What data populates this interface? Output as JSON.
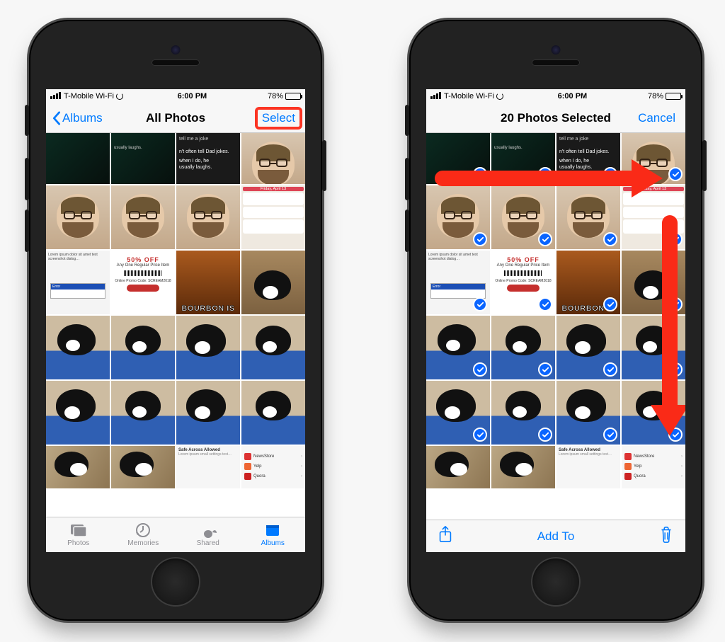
{
  "status": {
    "carrier": "T-Mobile Wi-Fi",
    "time": "6:00 PM",
    "battery_pct": "78%"
  },
  "left": {
    "back_label": "Albums",
    "title": "All Photos",
    "select_label": "Select",
    "tabs": {
      "photos": "Photos",
      "memories": "Memories",
      "shared": "Shared",
      "albums": "Albums"
    }
  },
  "right": {
    "title": "20 Photos Selected",
    "cancel_label": "Cancel",
    "toolbar": {
      "add_to": "Add To"
    }
  },
  "thumbs": {
    "bourbon_caption": "BOURBON IS",
    "coupon_headline": "50% OFF",
    "coupon_sub": "Any One Regular Price Item",
    "siri_lines": {
      "a": "tell me a joke",
      "b": "n't often tell Dad jokes.",
      "c": "when I do, he",
      "d": "usually laughs."
    },
    "notif_date": "Friday, April 13"
  }
}
